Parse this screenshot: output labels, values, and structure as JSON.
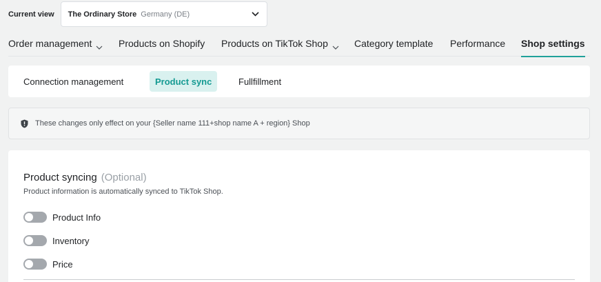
{
  "header": {
    "current_view_label": "Current view",
    "store_name": "The Ordinary Store",
    "store_region": "Germany (DE)"
  },
  "nav": {
    "items": [
      {
        "label": "Order management",
        "has_dropdown": true
      },
      {
        "label": "Products on Shopify",
        "has_dropdown": false
      },
      {
        "label": "Products on TikTok Shop",
        "has_dropdown": true
      },
      {
        "label": "Category template",
        "has_dropdown": false
      },
      {
        "label": "Performance",
        "has_dropdown": false
      },
      {
        "label": "Shop settings",
        "has_dropdown": false,
        "active": true
      }
    ]
  },
  "subtabs": {
    "items": [
      {
        "label": "Connection management"
      },
      {
        "label": "Product sync",
        "active": true
      },
      {
        "label": "Fullfillment"
      }
    ]
  },
  "notice": {
    "icon": "shield-icon",
    "text": "These changes only effect on your {Seller name 111+shop name A + region} Shop"
  },
  "product_syncing": {
    "title": "Product syncing",
    "optional": "(Optional)",
    "description": "Product information is automatically synced to TikTok Shop.",
    "toggles": [
      {
        "label": "Product Info",
        "enabled": false
      },
      {
        "label": "Inventory",
        "enabled": false
      },
      {
        "label": "Price",
        "enabled": false
      }
    ]
  },
  "colors": {
    "accent": "#1fa19a",
    "active_tab_bg": "#d9f1ef",
    "toggle_off": "#a4a8ad"
  }
}
